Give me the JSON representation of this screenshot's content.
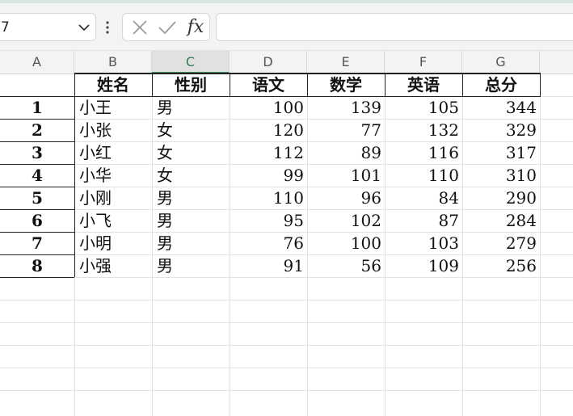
{
  "formula_bar": {
    "name_box_value": "7",
    "cancel_icon": "close-icon",
    "confirm_icon": "check-icon",
    "function_label": "fx",
    "formula_value": ""
  },
  "columns": [
    "A",
    "B",
    "C",
    "D",
    "E",
    "F",
    "G"
  ],
  "selected_column": "C",
  "table": {
    "headers": [
      "姓名",
      "性别",
      "语文",
      "数学",
      "英语",
      "总分"
    ],
    "rows": [
      {
        "rank": "1",
        "name": "小王",
        "gender": "男",
        "chinese": "100",
        "math": "139",
        "english": "105",
        "total": "344"
      },
      {
        "rank": "2",
        "name": "小张",
        "gender": "女",
        "chinese": "120",
        "math": "77",
        "english": "132",
        "total": "329"
      },
      {
        "rank": "3",
        "name": "小红",
        "gender": "女",
        "chinese": "112",
        "math": "89",
        "english": "116",
        "total": "317"
      },
      {
        "rank": "4",
        "name": "小华",
        "gender": "女",
        "chinese": "99",
        "math": "101",
        "english": "110",
        "total": "310"
      },
      {
        "rank": "5",
        "name": "小刚",
        "gender": "男",
        "chinese": "110",
        "math": "96",
        "english": "84",
        "total": "290"
      },
      {
        "rank": "6",
        "name": "小飞",
        "gender": "男",
        "chinese": "95",
        "math": "102",
        "english": "87",
        "total": "284"
      },
      {
        "rank": "7",
        "name": "小明",
        "gender": "男",
        "chinese": "76",
        "math": "100",
        "english": "103",
        "total": "279"
      },
      {
        "rank": "8",
        "name": "小强",
        "gender": "男",
        "chinese": "91",
        "math": "56",
        "english": "109",
        "total": "256"
      }
    ]
  }
}
